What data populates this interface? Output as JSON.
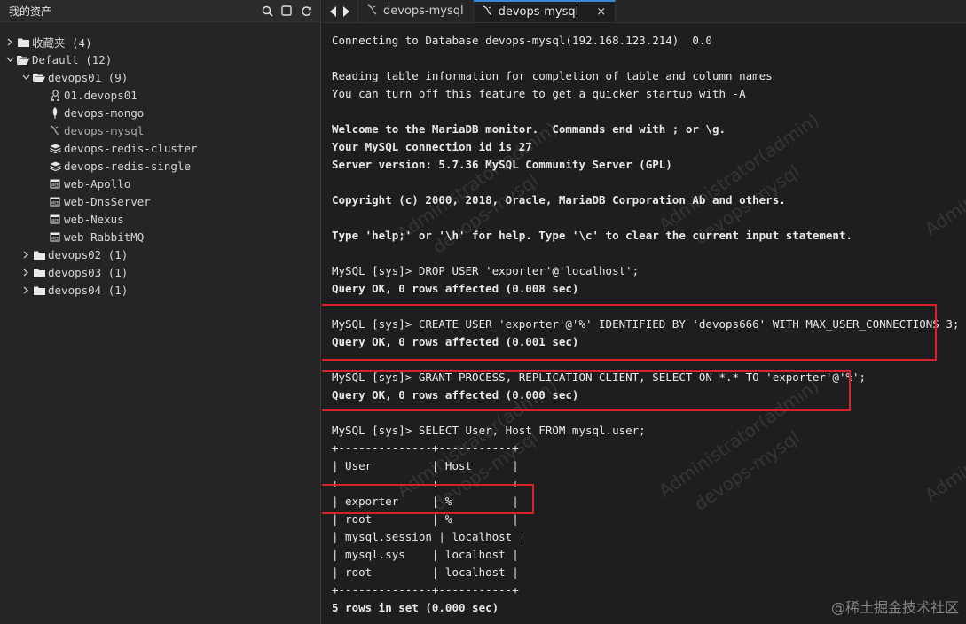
{
  "sidebar": {
    "title": "我的资产",
    "tree": [
      {
        "label": "收藏夹 (4)",
        "arrow": "right",
        "icon": "folder",
        "indent": 0
      },
      {
        "label": "Default (12)",
        "arrow": "down",
        "icon": "folder-open",
        "indent": 0
      },
      {
        "label": "devops01 (9)",
        "arrow": "down",
        "icon": "folder-open",
        "indent": 1
      },
      {
        "label": "01.devops01",
        "arrow": "",
        "icon": "linux",
        "indent": 2
      },
      {
        "label": "devops-mongo",
        "arrow": "",
        "icon": "mongo",
        "indent": 2
      },
      {
        "label": "devops-mysql",
        "arrow": "",
        "icon": "mysql",
        "indent": 2,
        "active": true
      },
      {
        "label": "devops-redis-cluster",
        "arrow": "",
        "icon": "redis",
        "indent": 2
      },
      {
        "label": "devops-redis-single",
        "arrow": "",
        "icon": "redis",
        "indent": 2
      },
      {
        "label": "web-Apollo",
        "arrow": "",
        "icon": "web",
        "indent": 2
      },
      {
        "label": "web-DnsServer",
        "arrow": "",
        "icon": "web",
        "indent": 2
      },
      {
        "label": "web-Nexus",
        "arrow": "",
        "icon": "web",
        "indent": 2
      },
      {
        "label": "web-RabbitMQ",
        "arrow": "",
        "icon": "web",
        "indent": 2
      },
      {
        "label": "devops02 (1)",
        "arrow": "right",
        "icon": "folder",
        "indent": 1
      },
      {
        "label": "devops03 (1)",
        "arrow": "right",
        "icon": "folder",
        "indent": 1
      },
      {
        "label": "devops04 (1)",
        "arrow": "right",
        "icon": "folder",
        "indent": 1
      }
    ]
  },
  "tabs": [
    {
      "label": "devops-mysql",
      "active": false
    },
    {
      "label": "devops-mysql",
      "active": true,
      "close": "×"
    }
  ],
  "terminal": {
    "lines": [
      {
        "text": "Connecting to Database devops-mysql(192.168.123.214)  0.0",
        "bold": false
      },
      {
        "text": "",
        "bold": false
      },
      {
        "text": "Reading table information for completion of table and column names",
        "bold": false
      },
      {
        "text": "You can turn off this feature to get a quicker startup with -A",
        "bold": false
      },
      {
        "text": "",
        "bold": false
      },
      {
        "text": "Welcome to the MariaDB monitor.  Commands end with ; or \\g.",
        "bold": true
      },
      {
        "text": "Your MySQL connection id is 27",
        "bold": true
      },
      {
        "text": "Server version: 5.7.36 MySQL Community Server (GPL)",
        "bold": true
      },
      {
        "text": "",
        "bold": false
      },
      {
        "text": "Copyright (c) 2000, 2018, Oracle, MariaDB Corporation Ab and others.",
        "bold": true
      },
      {
        "text": "",
        "bold": false
      },
      {
        "text": "Type 'help;' or '\\h' for help. Type '\\c' to clear the current input statement.",
        "bold": true
      },
      {
        "text": "",
        "bold": false
      },
      {
        "text": "MySQL [sys]> DROP USER 'exporter'@'localhost';",
        "bold": false
      },
      {
        "text": "Query OK, 0 rows affected (0.008 sec)",
        "bold": true
      },
      {
        "text": "",
        "bold": false
      },
      {
        "text": "MySQL [sys]> CREATE USER 'exporter'@'%' IDENTIFIED BY 'devops666' WITH MAX_USER_CONNECTIONS 3;",
        "bold": false
      },
      {
        "text": "Query OK, 0 rows affected (0.001 sec)",
        "bold": true
      },
      {
        "text": "",
        "bold": false
      },
      {
        "text": "MySQL [sys]> GRANT PROCESS, REPLICATION CLIENT, SELECT ON *.* TO 'exporter'@'%';",
        "bold": false
      },
      {
        "text": "Query OK, 0 rows affected (0.000 sec)",
        "bold": true
      },
      {
        "text": "",
        "bold": false
      },
      {
        "text": "MySQL [sys]> SELECT User, Host FROM mysql.user;",
        "bold": false
      },
      {
        "text": "+--------------+-----------+",
        "bold": false
      },
      {
        "text": "| User         | Host      |",
        "bold": false
      },
      {
        "text": "+--------------+-----------+",
        "bold": false
      },
      {
        "text": "| exporter     | %         |",
        "bold": false
      },
      {
        "text": "| root         | %         |",
        "bold": false
      },
      {
        "text": "| mysql.session | localhost |",
        "bold": false
      },
      {
        "text": "| mysql.sys    | localhost |",
        "bold": false
      },
      {
        "text": "| root         | localhost |",
        "bold": false
      },
      {
        "text": "+--------------+-----------+",
        "bold": false
      },
      {
        "text": "5 rows in set (0.000 sec)",
        "bold": true
      }
    ]
  },
  "watermarks": {
    "user": "Administrator(admin)",
    "host": "devops-mysql",
    "corner": "@稀土掘金技术社区"
  },
  "colors": {
    "highlight": "#d8212a",
    "tab_accent": "#3a88d8"
  }
}
